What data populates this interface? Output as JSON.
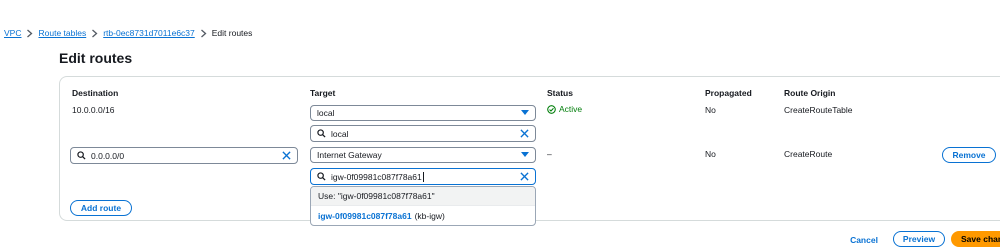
{
  "breadcrumb": {
    "items": [
      "VPC",
      "Route tables",
      "rtb-0ec8731d7011e6c37"
    ],
    "current": "Edit routes"
  },
  "page": {
    "title": "Edit routes"
  },
  "table": {
    "headers": {
      "destination": "Destination",
      "target": "Target",
      "status": "Status",
      "propagated": "Propagated",
      "route_origin": "Route Origin"
    },
    "rows": [
      {
        "destination": "10.0.0.0/16",
        "target": "local",
        "target_filter": "local",
        "status": "Active",
        "propagated": "No",
        "route_origin": "CreateRouteTable"
      },
      {
        "destination": "0.0.0.0/0",
        "target": "Internet Gateway",
        "target_filter": "igw-0f09981c087f78a61",
        "status": "–",
        "propagated": "No",
        "route_origin": "CreateRoute",
        "remove_label": "Remove"
      }
    ]
  },
  "dropdown": {
    "use_prefix": "Use:",
    "use_value": "\"igw-0f09981c087f78a61\"",
    "option_id": "igw-0f09981c087f78a61",
    "option_name": "(kb-igw)"
  },
  "actions": {
    "add_route": "Add route",
    "cancel": "Cancel",
    "preview": "Preview",
    "save": "Save changes"
  },
  "colors": {
    "link": "#0972d3",
    "success": "#037f0c",
    "primary_button": "#ff9900",
    "border": "#d5dbdb"
  },
  "icons": [
    "chevron-right-icon",
    "caret-down-icon",
    "search-icon",
    "clear-icon",
    "status-check-icon"
  ]
}
